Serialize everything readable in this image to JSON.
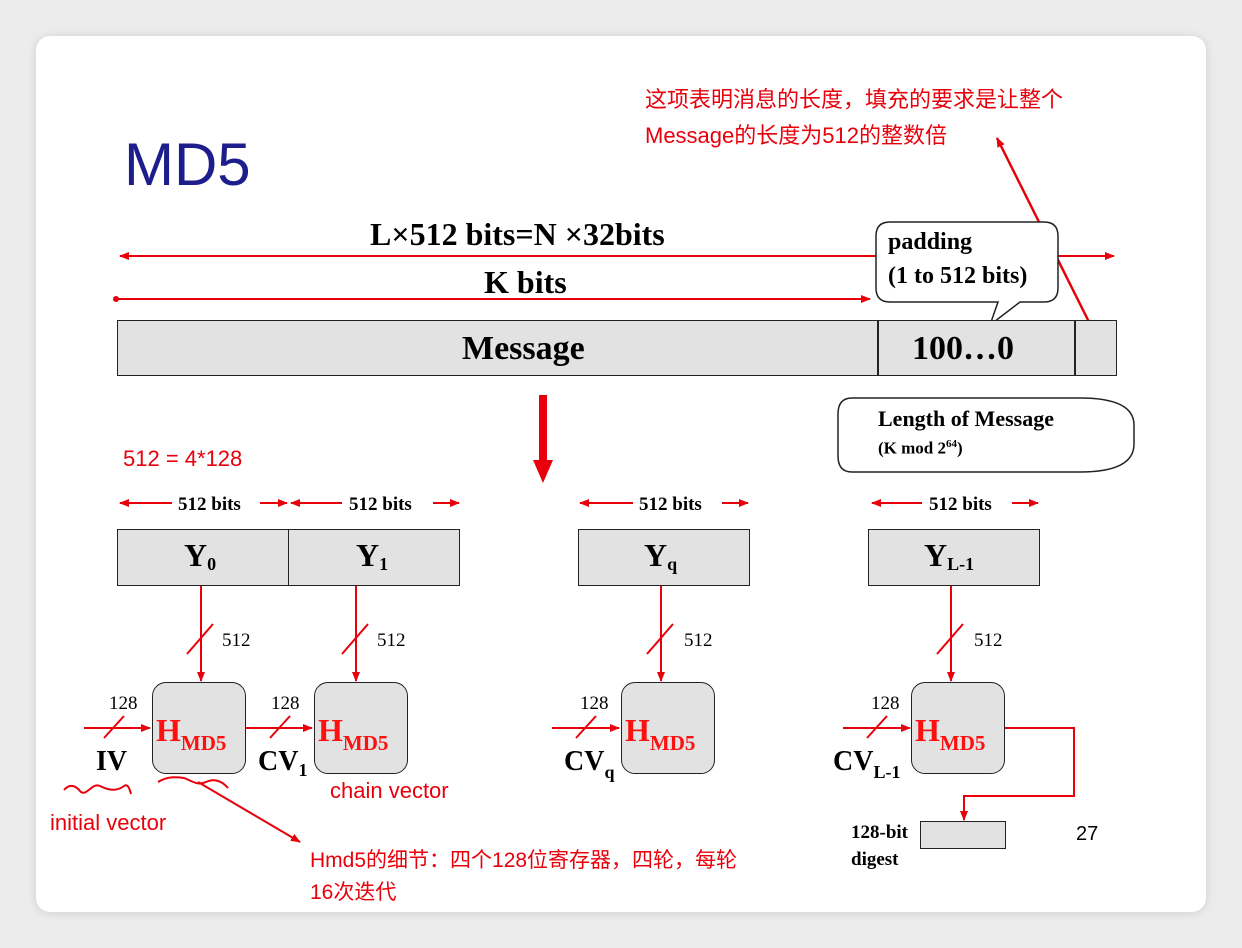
{
  "title": "MD5",
  "top_note": {
    "line1": "这项表明消息的长度，填充的要求是让整个",
    "line2": "Message的长度为512的整数倍"
  },
  "labels": {
    "total_bits": "L×512 bits=N ×32bits",
    "k_bits": "K bits",
    "message": "Message",
    "padding_value": "100…0",
    "padding_callout_line1": "padding",
    "padding_callout_line2": "(1 to 512 bits)",
    "length_callout_line1": "Length of Message",
    "length_callout_line2_prefix": "(K mod 2",
    "length_callout_exp": "64",
    "length_callout_line2_suffix": ")",
    "block_eq": "512 = 4*128",
    "block_bits": "512  bits",
    "bus_512": "512",
    "bus_128": "128",
    "iv": "IV",
    "cv_main": "CV",
    "digest_line1": "128-bit",
    "digest_line2": "digest",
    "page_number": "27"
  },
  "blocks": [
    {
      "main": "Y",
      "sub": "0"
    },
    {
      "main": "Y",
      "sub": "1"
    },
    {
      "main": "Y",
      "sub": "q"
    },
    {
      "main": "Y",
      "sub": "L-1"
    }
  ],
  "hash_units": [
    {
      "main": "H",
      "sub": "MD5"
    },
    {
      "main": "H",
      "sub": "MD5"
    },
    {
      "main": "H",
      "sub": "MD5"
    },
    {
      "main": "H",
      "sub": "MD5"
    }
  ],
  "chain_inputs": [
    {
      "sub": "1"
    },
    {
      "sub": "q"
    },
    {
      "sub": "L-1"
    }
  ],
  "annotations": {
    "chain_vector": "chain vector",
    "initial_vector": "initial vector",
    "hmd5_detail_line1": "Hmd5的细节：四个128位寄存器，四轮，每轮",
    "hmd5_detail_line2": "16次迭代"
  },
  "colors": {
    "annotation_red": "#e8000b",
    "title_blue": "#1d1d8c",
    "box_fill": "#e2e2e2"
  }
}
